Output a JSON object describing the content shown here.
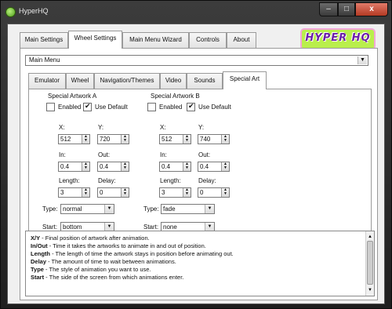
{
  "window": {
    "title": "HyperHQ",
    "minimize": "–",
    "maximize": "□",
    "close": "x"
  },
  "logo_text": "HYPER HQ",
  "main_tabs": [
    {
      "label": "Main Settings"
    },
    {
      "label": "Wheel Settings"
    },
    {
      "label": "Main Menu Wizard"
    },
    {
      "label": "Controls"
    },
    {
      "label": "About"
    }
  ],
  "menu_select": {
    "value": "Main Menu"
  },
  "sub_tabs": [
    {
      "label": "Emulator"
    },
    {
      "label": "Wheel"
    },
    {
      "label": "Navigation/Themes"
    },
    {
      "label": "Video"
    },
    {
      "label": "Sounds"
    },
    {
      "label": "Special Art"
    }
  ],
  "artA": {
    "title": "Special Artwork A",
    "enabled_label": "Enabled",
    "enabled": false,
    "use_default_label": "Use Default",
    "use_default": true,
    "x_label": "X:",
    "x": "512",
    "y_label": "Y:",
    "y": "720",
    "in_label": "In:",
    "in": "0.4",
    "out_label": "Out:",
    "out": "0.4",
    "length_label": "Length:",
    "length": "3",
    "delay_label": "Delay:",
    "delay": "0",
    "type_label": "Type:",
    "type": "normal",
    "start_label": "Start:",
    "start": "bottom"
  },
  "artB": {
    "title": "Special Artwork B",
    "enabled_label": "Enabled",
    "enabled": false,
    "use_default_label": "Use Default",
    "use_default": true,
    "x_label": "X:",
    "x": "512",
    "y_label": "Y:",
    "y": "740",
    "in_label": "In:",
    "in": "0.4",
    "out_label": "Out:",
    "out": "0.4",
    "length_label": "Length:",
    "length": "3",
    "delay_label": "Delay:",
    "delay": "0",
    "type_label": "Type:",
    "type": "fade",
    "start_label": "Start:",
    "start": "none"
  },
  "help": [
    {
      "term": "X/Y",
      "text": " - Final position of artwork after animation."
    },
    {
      "term": "In/Out",
      "text": " - Time it takes the artworks to animate in and out of position."
    },
    {
      "term": "Length",
      "text": " - The length of time the artwork stays in position before animating out."
    },
    {
      "term": "Delay",
      "text": " - The amount of time to wait between animations."
    },
    {
      "term": "Type",
      "text": " - The style of animation you want to use."
    },
    {
      "term": "Start",
      "text": " - The side of the screen from which animations enter."
    }
  ],
  "glyphs": {
    "spin_up": "▲",
    "spin_down": "▼",
    "combo_arrow": "▼",
    "scroll_up": "▲",
    "scroll_down": "▼"
  }
}
